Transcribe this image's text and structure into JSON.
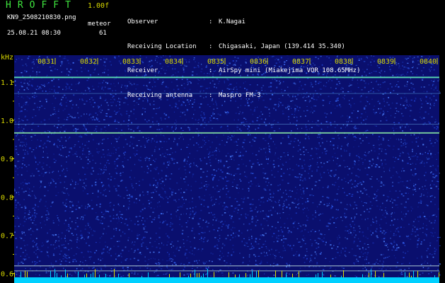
{
  "header": {
    "app_title": "HROFFT",
    "version": "1.00f",
    "filename": "KN9_2508210830.png",
    "meteor_label": "meteor",
    "datetime": "25.08.21 08:30",
    "meteor_count": "61"
  },
  "info": [
    {
      "key": "Observer",
      "sep": ":",
      "value": "K.Nagai"
    },
    {
      "key": "Receiving Location",
      "sep": ":",
      "value": "Chigasaki, Japan (139.414 35.340)"
    },
    {
      "key": "Receiver",
      "sep": ":",
      "value": "AirSpy mini (Miakejima VOR 108.65MHz)"
    },
    {
      "key": "Receiving antenna",
      "sep": ":",
      "value": "Maspro FM-3"
    }
  ],
  "spectrogram": {
    "y_unit": "kHz",
    "time_labels": [
      "0831",
      "0832",
      "0833",
      "0834",
      "0835",
      "0836",
      "0837",
      "0838",
      "0839",
      "0840"
    ],
    "freq_ticks": [
      1.1,
      1.0,
      0.9,
      0.8,
      0.7,
      0.6
    ],
    "freq_labels": [
      "1.1",
      "1.0",
      "0.9",
      "0.8",
      "0.7",
      "0.6"
    ],
    "freq_range": [
      0.59,
      1.17
    ],
    "lines": [
      {
        "freq": 1.112,
        "color": "#5fe6b8",
        "strength": "strong"
      },
      {
        "freq": 1.07,
        "color": "#4a8fd0",
        "strength": "faint"
      },
      {
        "freq": 0.99,
        "color": "#5a9ad8",
        "strength": "faint"
      },
      {
        "freq": 0.967,
        "color": "#7fd8a0",
        "strength": "strong"
      },
      {
        "freq": 0.62,
        "color": "#9ab4c8",
        "strength": "medium"
      },
      {
        "freq": 0.607,
        "color": "#8aa4b8",
        "strength": "medium"
      }
    ],
    "colors": {
      "background": "#0a0f6e",
      "label": "#d8d800",
      "baseline": "#00d0ff"
    }
  }
}
